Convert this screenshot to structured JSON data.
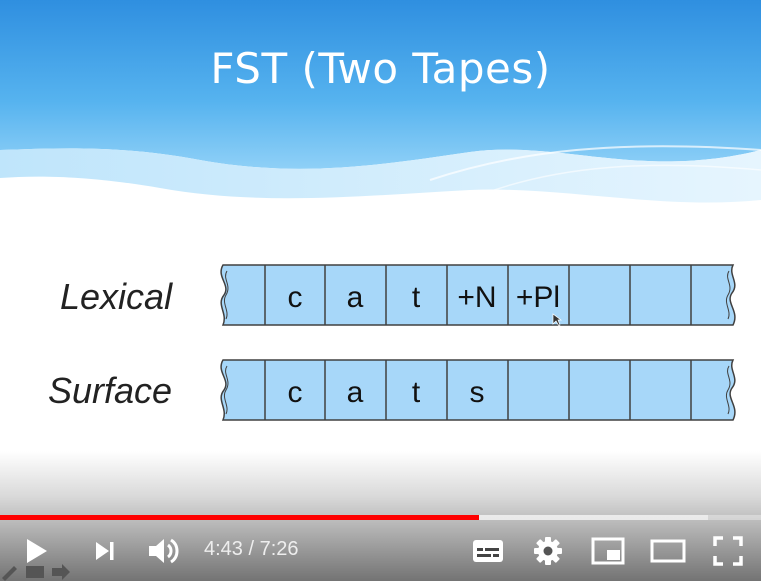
{
  "slide": {
    "title": "FST (Two Tapes)",
    "tapes": [
      {
        "label": "Lexical",
        "cells": [
          "c",
          "a",
          "t",
          "+N",
          "+Pl",
          "",
          "",
          ""
        ]
      },
      {
        "label": "Surface",
        "cells": [
          "c",
          "a",
          "t",
          "s",
          "",
          "",
          "",
          ""
        ]
      }
    ]
  },
  "player": {
    "current_time": "4:43",
    "separator": "/",
    "duration": "7:26",
    "progress_fraction": 0.63,
    "buffered_fraction": 0.93,
    "accent_color": "#ff0000"
  },
  "controls": {
    "play_icon": "play-icon",
    "next_icon": "next-icon",
    "volume_icon": "volume-icon",
    "subtitles_icon": "subtitles-icon",
    "settings_icon": "gear-icon",
    "miniplayer_icon": "miniplayer-icon",
    "theater_icon": "theater-mode-icon",
    "fullscreen_icon": "fullscreen-icon"
  }
}
